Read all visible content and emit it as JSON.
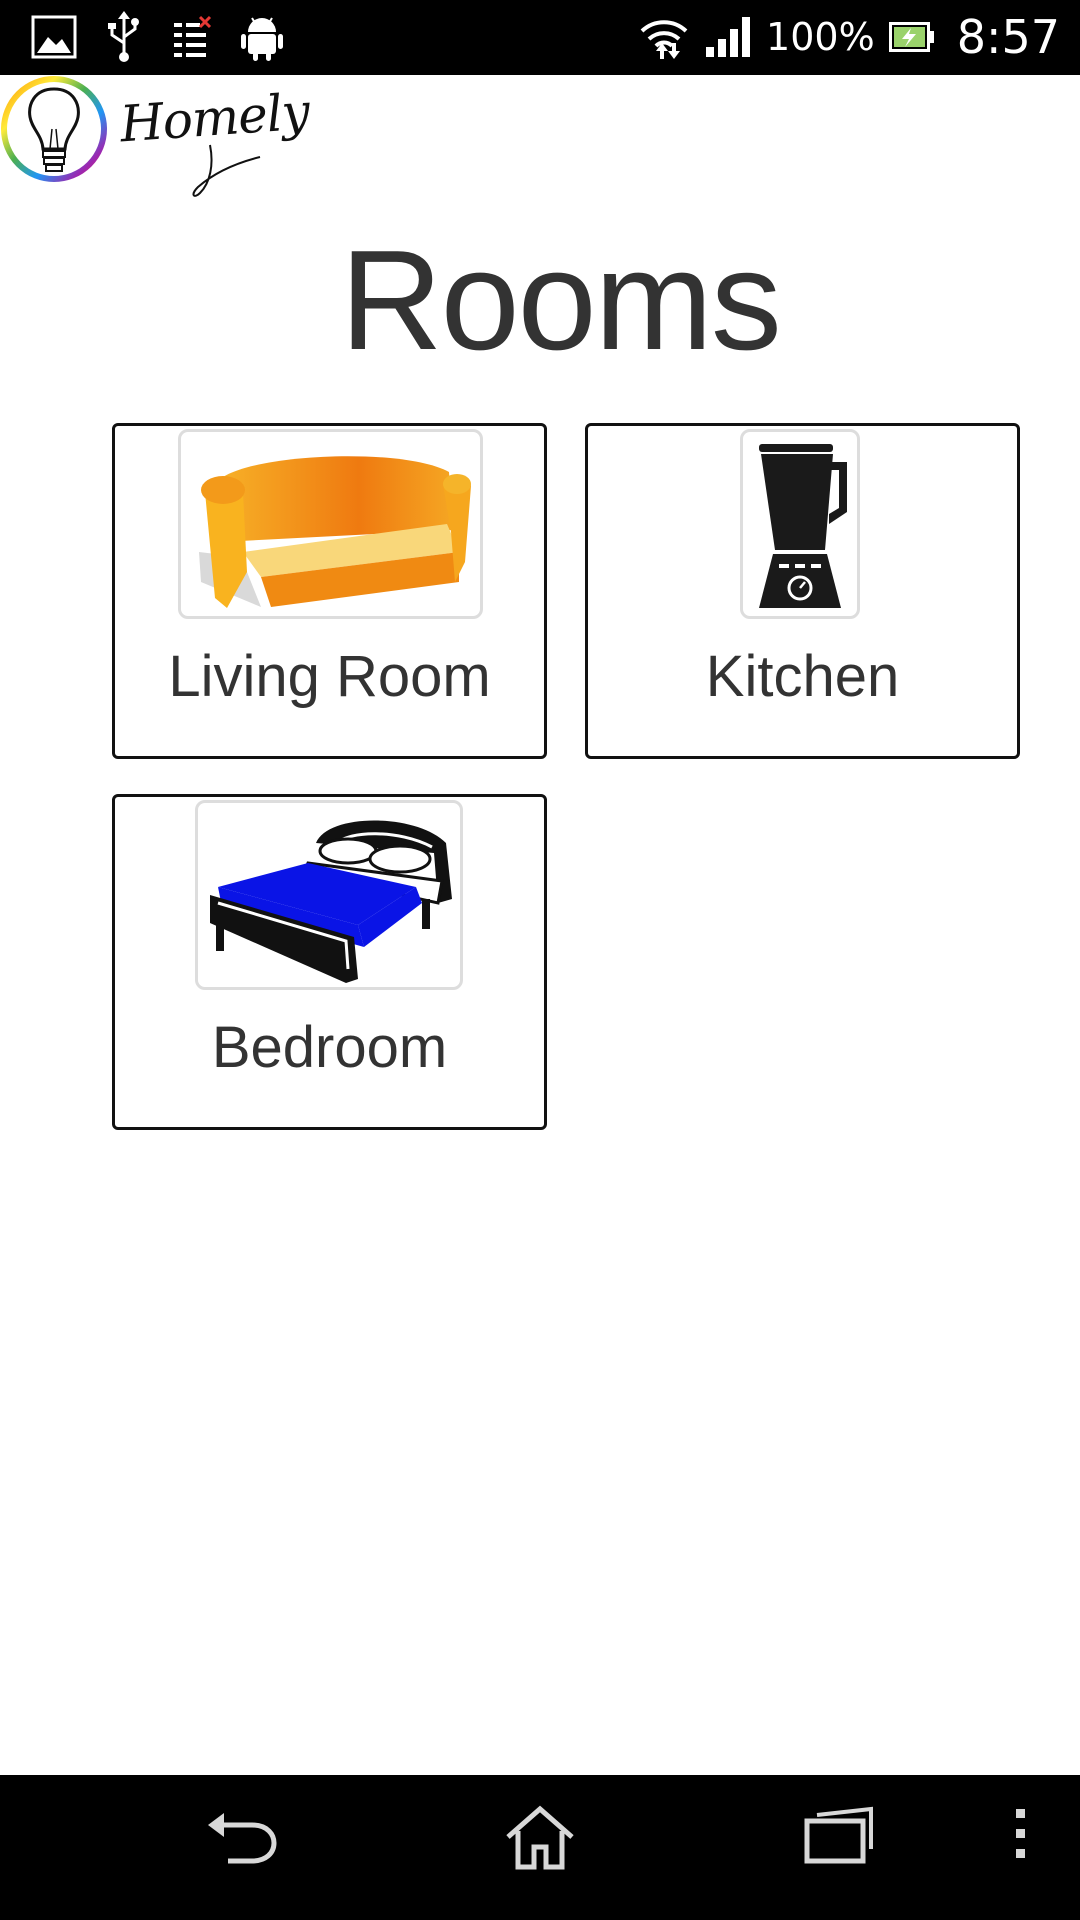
{
  "status_bar": {
    "notification_icons": [
      "gallery-icon",
      "usb-icon",
      "sync-error-icon",
      "android-icon"
    ],
    "system_icons": [
      "wifi-icon",
      "signal-icon",
      "battery-icon"
    ],
    "battery_percent": "100%",
    "clock": "8:57"
  },
  "app": {
    "logo_text": "Homely",
    "logo_icon": "lightbulb-logo-icon"
  },
  "page": {
    "title": "Rooms"
  },
  "rooms": [
    {
      "label": "Living Room",
      "icon": "sofa-icon"
    },
    {
      "label": "Kitchen",
      "icon": "blender-icon"
    },
    {
      "label": "Bedroom",
      "icon": "bed-icon"
    }
  ],
  "nav_bar": {
    "buttons": [
      "back-icon",
      "home-icon",
      "recents-icon",
      "overflow-menu-icon"
    ]
  },
  "colors": {
    "status_bar_bg": "#000000",
    "background": "#ffffff",
    "title_text": "#333333",
    "card_border": "#111111",
    "sofa": "#f29a1c",
    "bed_blanket": "#0a14e6"
  }
}
